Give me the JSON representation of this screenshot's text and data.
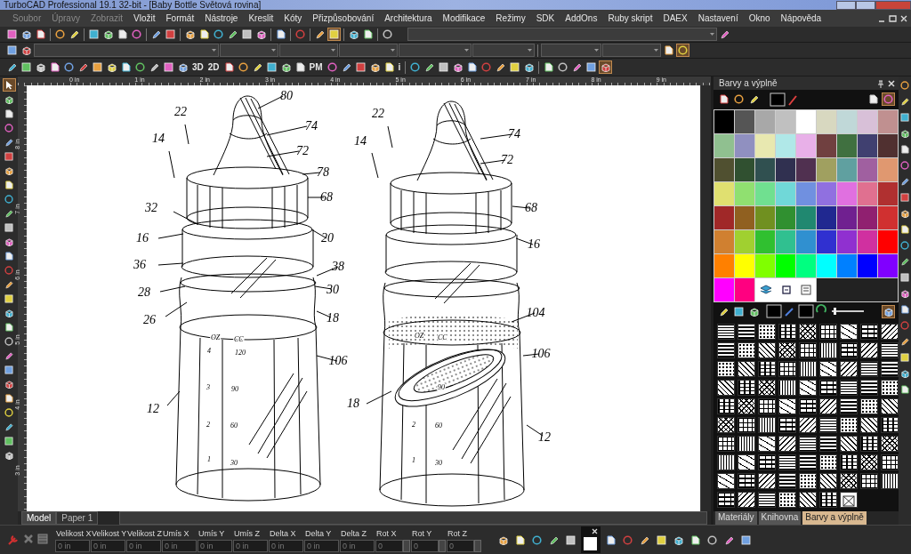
{
  "window": {
    "title": "TurboCAD Professional 19.1 32-bit - [Baby Bottle Světová rovina]"
  },
  "menu": [
    {
      "label": "Soubor",
      "disabled": true
    },
    {
      "label": "Úpravy",
      "disabled": true
    },
    {
      "label": "Zobrazit",
      "disabled": true
    },
    {
      "label": "Vložit",
      "disabled": false
    },
    {
      "label": "Formát",
      "disabled": false
    },
    {
      "label": "Nástroje",
      "disabled": false
    },
    {
      "label": "Kreslit",
      "disabled": false
    },
    {
      "label": "Kóty",
      "disabled": false
    },
    {
      "label": "Přizpůsobování",
      "disabled": false
    },
    {
      "label": "Architektura",
      "disabled": false
    },
    {
      "label": "Modifikace",
      "disabled": false
    },
    {
      "label": "Režimy",
      "disabled": false
    },
    {
      "label": "SDK",
      "disabled": false
    },
    {
      "label": "AddOns",
      "disabled": false
    },
    {
      "label": "Ruby skript",
      "disabled": false
    },
    {
      "label": "DAEX",
      "disabled": false
    },
    {
      "label": "Nastavení",
      "disabled": false
    },
    {
      "label": "Okno",
      "disabled": false
    },
    {
      "label": "Nápověda",
      "disabled": false
    }
  ],
  "toolbar_rows": [
    [
      {
        "kind": "icon",
        "selected": false
      },
      {
        "kind": "icon",
        "selected": false
      },
      {
        "kind": "icon",
        "selected": false
      },
      {
        "kind": "sep"
      },
      {
        "kind": "icon",
        "selected": false
      },
      {
        "kind": "icon",
        "selected": false
      },
      {
        "kind": "sep"
      },
      {
        "kind": "icon",
        "selected": false
      },
      {
        "kind": "icon",
        "selected": false
      },
      {
        "kind": "icon",
        "selected": false
      },
      {
        "kind": "icon",
        "selected": false
      },
      {
        "kind": "sep"
      },
      {
        "kind": "icon",
        "selected": false
      },
      {
        "kind": "icon",
        "selected": false
      },
      {
        "kind": "sep"
      },
      {
        "kind": "icon",
        "selected": false
      },
      {
        "kind": "icon",
        "selected": false
      },
      {
        "kind": "icon",
        "selected": false
      },
      {
        "kind": "icon",
        "selected": false
      },
      {
        "kind": "icon",
        "selected": false
      },
      {
        "kind": "icon",
        "selected": false
      },
      {
        "kind": "sep"
      },
      {
        "kind": "icon",
        "selected": false
      },
      {
        "kind": "sep"
      },
      {
        "kind": "icon",
        "selected": false
      },
      {
        "kind": "sep"
      },
      {
        "kind": "icon",
        "selected": false
      },
      {
        "kind": "icon",
        "selected": true
      },
      {
        "kind": "sep"
      },
      {
        "kind": "icon",
        "selected": false
      },
      {
        "kind": "icon",
        "selected": false
      },
      {
        "kind": "sep"
      },
      {
        "kind": "icon",
        "selected": false
      },
      {
        "kind": "combo"
      },
      {
        "kind": "icon",
        "selected": false
      }
    ],
    [
      {
        "kind": "icon",
        "selected": false
      },
      {
        "kind": "icon",
        "selected": false
      },
      {
        "kind": "combo"
      },
      {
        "kind": "combo"
      },
      {
        "kind": "combo"
      },
      {
        "kind": "combo"
      },
      {
        "kind": "combo"
      },
      {
        "kind": "combo"
      },
      {
        "kind": "sep"
      },
      {
        "kind": "combo"
      },
      {
        "kind": "combo"
      },
      {
        "kind": "icon",
        "selected": false
      },
      {
        "kind": "icon",
        "selected": true
      }
    ],
    [
      {
        "kind": "icon",
        "selected": false
      },
      {
        "kind": "icon",
        "selected": false
      },
      {
        "kind": "icon",
        "selected": false
      },
      {
        "kind": "icon",
        "selected": false
      },
      {
        "kind": "icon",
        "selected": false
      },
      {
        "kind": "icon",
        "selected": false
      },
      {
        "kind": "icon",
        "selected": false
      },
      {
        "kind": "icon",
        "selected": false
      },
      {
        "kind": "icon",
        "selected": false
      },
      {
        "kind": "icon",
        "selected": false
      },
      {
        "kind": "icon",
        "selected": false
      },
      {
        "kind": "icon",
        "selected": false
      },
      {
        "kind": "icon",
        "selected": false
      },
      {
        "kind": "text",
        "label": "3D"
      },
      {
        "kind": "text",
        "label": "2D"
      },
      {
        "kind": "icon",
        "selected": false
      },
      {
        "kind": "icon",
        "selected": false
      },
      {
        "kind": "icon",
        "selected": false
      },
      {
        "kind": "icon",
        "selected": false
      },
      {
        "kind": "icon",
        "selected": false
      },
      {
        "kind": "icon",
        "selected": false
      },
      {
        "kind": "text",
        "label": "PM"
      },
      {
        "kind": "icon",
        "selected": false
      },
      {
        "kind": "icon",
        "selected": false
      },
      {
        "kind": "icon",
        "selected": false
      },
      {
        "kind": "icon",
        "selected": false
      },
      {
        "kind": "icon",
        "selected": false
      },
      {
        "kind": "text",
        "label": "i"
      },
      {
        "kind": "sep"
      },
      {
        "kind": "icon",
        "selected": false
      },
      {
        "kind": "icon",
        "selected": false
      },
      {
        "kind": "icon",
        "selected": false
      },
      {
        "kind": "icon",
        "selected": false
      },
      {
        "kind": "icon",
        "selected": false
      },
      {
        "kind": "icon",
        "selected": false
      },
      {
        "kind": "icon",
        "selected": false
      },
      {
        "kind": "icon",
        "selected": false
      },
      {
        "kind": "icon",
        "selected": false
      },
      {
        "kind": "sep"
      },
      {
        "kind": "icon",
        "selected": false
      },
      {
        "kind": "icon",
        "selected": false
      },
      {
        "kind": "icon",
        "selected": false
      },
      {
        "kind": "icon",
        "selected": false
      },
      {
        "kind": "icon",
        "selected": true
      }
    ]
  ],
  "left_tools": [
    {
      "selected": true
    },
    {
      "selected": false
    },
    {
      "selected": false
    },
    {
      "selected": false
    },
    {
      "selected": false
    },
    {
      "selected": false
    },
    {
      "selected": false
    },
    {
      "selected": false
    },
    {
      "selected": false
    },
    {
      "selected": false
    },
    {
      "selected": false
    },
    {
      "selected": false
    },
    {
      "selected": false
    },
    {
      "selected": false
    },
    {
      "selected": false
    },
    {
      "selected": false
    },
    {
      "selected": false
    },
    {
      "selected": false
    },
    {
      "selected": false
    },
    {
      "selected": false
    },
    {
      "selected": false
    },
    {
      "selected": false
    },
    {
      "selected": false
    },
    {
      "selected": false
    },
    {
      "selected": false
    },
    {
      "selected": false
    },
    {
      "selected": false
    }
  ],
  "ruler": {
    "top": [
      "0 in",
      "1 in",
      "2 in",
      "3 in",
      "4 in",
      "5 in",
      "6 in",
      "7 in",
      "8 in",
      "9 in"
    ],
    "left": [
      "8 in",
      "7 in",
      "6 in",
      "5 in",
      "4 in",
      "3 in"
    ]
  },
  "drawing": {
    "bottles": [
      {
        "callouts": [
          "22",
          "80",
          "74",
          "14",
          "72",
          "78",
          "68",
          "32",
          "16",
          "20",
          "36",
          "38",
          "28",
          "30",
          "26",
          "18",
          "106",
          "12"
        ],
        "scale": [
          "OZ",
          "CC",
          "4",
          "120",
          "3",
          "90",
          "2",
          "60",
          "1",
          "30"
        ]
      },
      {
        "callouts": [
          "22",
          "74",
          "14",
          "72",
          "68",
          "16",
          "104",
          "106",
          "18",
          "12"
        ],
        "scale": [
          "OZ",
          "CC",
          "90",
          "2",
          "60",
          "1",
          "30"
        ]
      }
    ]
  },
  "sheet_tabs": [
    {
      "label": "Model",
      "selected": true
    },
    {
      "label": "Paper 1",
      "selected": false
    }
  ],
  "panel": {
    "title": "Barvy a výplně",
    "swatches": [
      {
        "color": "#000000"
      },
      {
        "color": "#555555"
      },
      {
        "color": "#a8a8a8"
      },
      {
        "color": "#c0c0c0"
      },
      {
        "color": "#ffffff"
      },
      {
        "color": "#d8d8c0"
      },
      {
        "color": "#c0d8d8"
      },
      {
        "color": "#d8c0d8"
      },
      {
        "color": "#c09090"
      },
      {
        "color": "#90c090"
      },
      {
        "color": "#9090c0"
      },
      {
        "color": "#e8e8b0"
      },
      {
        "color": "#b0e8e8"
      },
      {
        "color": "#e8b0e8"
      },
      {
        "color": "#704040"
      },
      {
        "color": "#407040"
      },
      {
        "color": "#404070"
      },
      {
        "color": "#503030"
      },
      {
        "color": "#505030"
      },
      {
        "color": "#305030"
      },
      {
        "color": "#305050"
      },
      {
        "color": "#303050"
      },
      {
        "color": "#503050"
      },
      {
        "color": "#a0a060"
      },
      {
        "color": "#60a0a0"
      },
      {
        "color": "#a060a0"
      },
      {
        "color": "#e09870"
      },
      {
        "color": "#e0e070"
      },
      {
        "color": "#90e070"
      },
      {
        "color": "#70e090"
      },
      {
        "color": "#70d8d8"
      },
      {
        "color": "#7090e0"
      },
      {
        "color": "#9070e0"
      },
      {
        "color": "#e070e0"
      },
      {
        "color": "#e07090"
      },
      {
        "color": "#b03030"
      },
      {
        "color": "#a02828"
      },
      {
        "color": "#906020"
      },
      {
        "color": "#709020"
      },
      {
        "color": "#309030"
      },
      {
        "color": "#208870"
      },
      {
        "color": "#202890"
      },
      {
        "color": "#702090"
      },
      {
        "color": "#902070"
      },
      {
        "color": "#d03030"
      },
      {
        "color": "#d08030"
      },
      {
        "color": "#a0d030"
      },
      {
        "color": "#30c030"
      },
      {
        "color": "#30c090"
      },
      {
        "color": "#3090d0"
      },
      {
        "color": "#3030d0"
      },
      {
        "color": "#9030d0"
      },
      {
        "color": "#d030a0"
      },
      {
        "color": "#ff0000"
      },
      {
        "color": "#ff8000"
      },
      {
        "color": "#ffff00"
      },
      {
        "color": "#80ff00"
      },
      {
        "color": "#00ff00"
      },
      {
        "color": "#00ff80"
      },
      {
        "color": "#00ffff"
      },
      {
        "color": "#0080ff"
      },
      {
        "color": "#0000ff"
      },
      {
        "color": "#8000ff"
      },
      {
        "color": "#ff00ff"
      },
      {
        "color": "#ff0080"
      }
    ]
  },
  "panel_tabs": [
    {
      "label": "Materiály",
      "selected": false
    },
    {
      "label": "Knihovna",
      "selected": false
    },
    {
      "label": "Barvy a výplně",
      "selected": true
    }
  ],
  "status": {
    "fields": [
      {
        "label": "Velikost X",
        "value": "0 in",
        "kind": "text"
      },
      {
        "label": "Velikost Y",
        "value": "0 in",
        "kind": "text"
      },
      {
        "label": "Velikost Z",
        "value": "0 in",
        "kind": "text"
      },
      {
        "label": "Umís X",
        "value": "0 in",
        "kind": "text"
      },
      {
        "label": "Umís Y",
        "value": "0 in",
        "kind": "text"
      },
      {
        "label": "Umís Z",
        "value": "0 in",
        "kind": "text"
      },
      {
        "label": "Delta X",
        "value": "0 in",
        "kind": "text"
      },
      {
        "label": "Delta Y",
        "value": "0 in",
        "kind": "text"
      },
      {
        "label": "Delta Z",
        "value": "0 in",
        "kind": "text"
      },
      {
        "label": "Rot X",
        "value": "0",
        "kind": "spin"
      },
      {
        "label": "Rot Y",
        "value": "0",
        "kind": "spin"
      },
      {
        "label": "Rot Z",
        "value": "0",
        "kind": "spin"
      }
    ]
  }
}
